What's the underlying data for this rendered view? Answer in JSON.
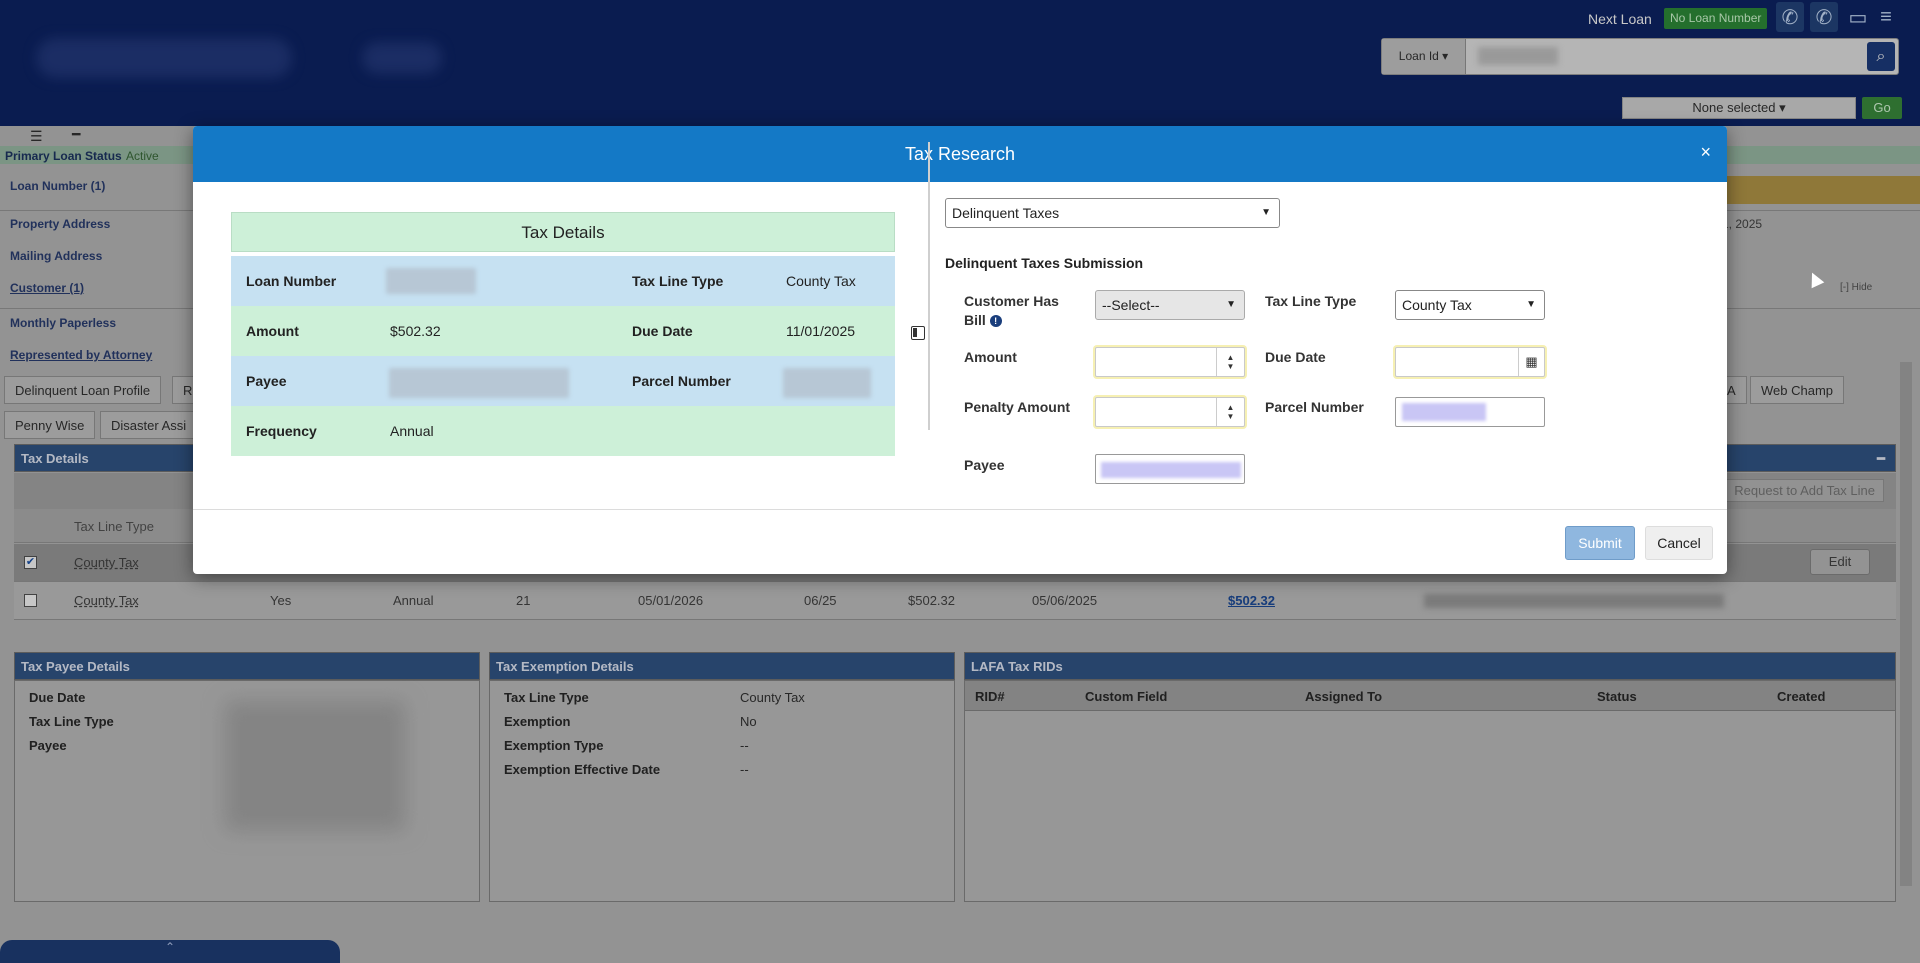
{
  "header": {
    "next_loan_label": "Next Loan",
    "no_loan_badge": "No Loan Number",
    "loan_id_dropdown": "Loan Id ▾",
    "none_selected": "None selected ▾",
    "go_label": "Go"
  },
  "background": {
    "primary_loan_status_label": "Primary Loan Status",
    "primary_loan_status_value": "Active",
    "rows": [
      "Loan Number (1)",
      "Property Address",
      "Mailing Address",
      "Customer (1)",
      "Monthly Paperless",
      "Represented by Attorney"
    ],
    "right_date": "1, 2025",
    "hide_label": "[-] Hide",
    "tabs_row1": [
      "Delinquent Loan Profile",
      "R",
      "A",
      "Web Champ"
    ],
    "tabs_row2": [
      "Penny Wise",
      "Disaster Assi"
    ],
    "tax_details_panel": "Tax Details",
    "request_add_tax_line": "Request to Add Tax Line",
    "grid_header": "Tax Line Type",
    "edit_label": "Edit",
    "grid_rows": [
      {
        "type": "County Tax"
      },
      {
        "type": "County Tax",
        "yes": "Yes",
        "freq": "Annual",
        "num": "21",
        "date1": "05/01/2026",
        "period": "06/25",
        "amt": "$502.32",
        "date2": "05/06/2025",
        "link": "$502.32"
      }
    ],
    "tax_payee_panel": {
      "title": "Tax Payee Details",
      "labels": [
        "Due Date",
        "Tax Line Type",
        "Payee"
      ]
    },
    "tax_exemption_panel": {
      "title": "Tax Exemption Details",
      "labels": [
        "Tax Line Type",
        "Exemption",
        "Exemption Type",
        "Exemption Effective Date"
      ],
      "values": [
        "County Tax",
        "No",
        "--",
        "--"
      ]
    },
    "lafa_panel": {
      "title": "LAFA Tax RIDs",
      "columns": [
        "RID#",
        "Custom Field",
        "Assigned To",
        "Status",
        "Created"
      ]
    },
    "bottom_tab_chevron": "⌃"
  },
  "modal": {
    "title": "Tax Research",
    "close": "×",
    "details": {
      "title": "Tax Details",
      "loan_number_label": "Loan Number",
      "tax_line_type_label": "Tax Line Type",
      "tax_line_type_value": "County Tax",
      "amount_label": "Amount",
      "amount_value": "$502.32",
      "due_date_label": "Due Date",
      "due_date_value": "11/01/2025",
      "payee_label": "Payee",
      "parcel_number_label": "Parcel Number",
      "frequency_label": "Frequency",
      "frequency_value": "Annual"
    },
    "form": {
      "type_select": "Delinquent Taxes",
      "heading": "Delinquent Taxes Submission",
      "customer_has_bill_label": "Customer Has Bill",
      "customer_has_bill_value": "--Select--",
      "tax_line_type_label": "Tax Line Type",
      "tax_line_type_value": "County Tax",
      "amount_label": "Amount",
      "due_date_label": "Due Date",
      "penalty_amount_label": "Penalty Amount",
      "parcel_number_label": "Parcel Number",
      "payee_label": "Payee"
    },
    "submit_label": "Submit",
    "cancel_label": "Cancel"
  }
}
